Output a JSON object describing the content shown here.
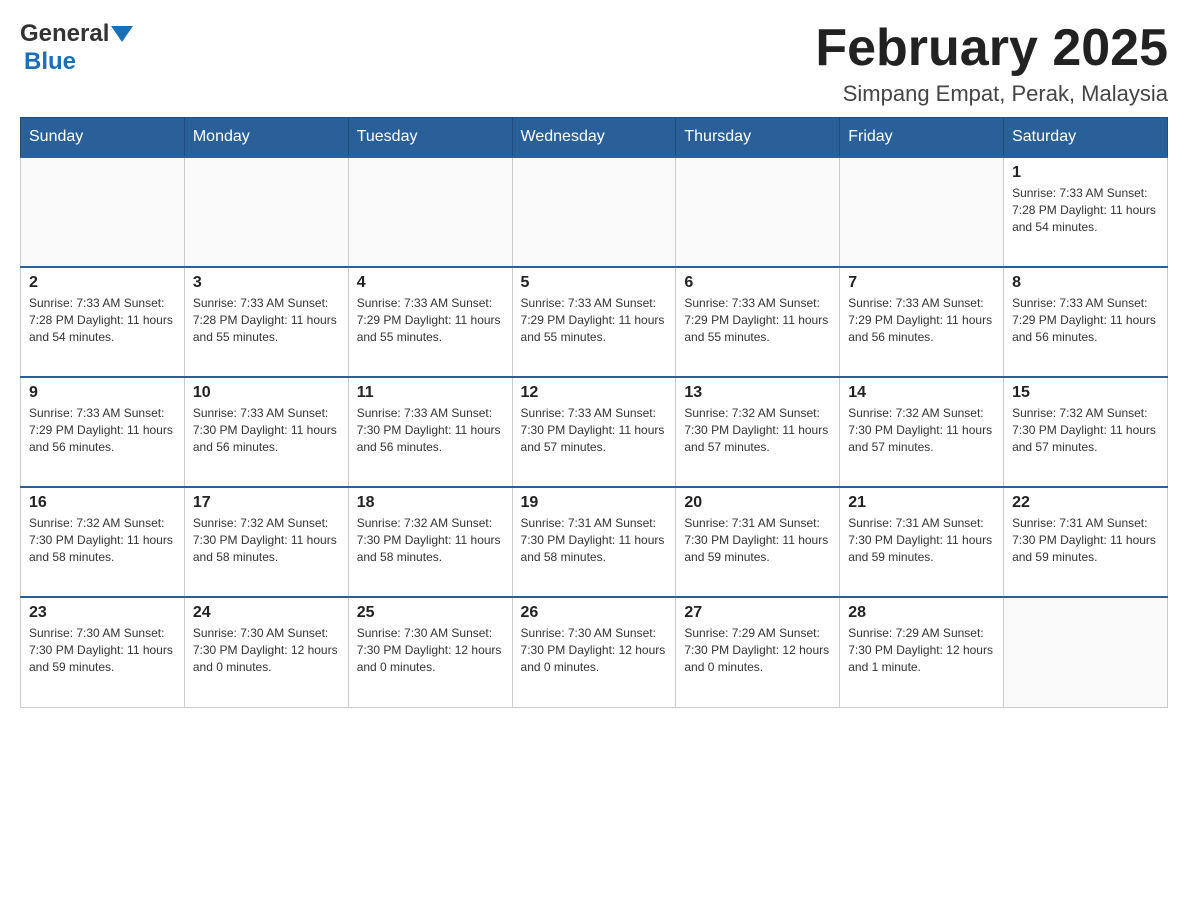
{
  "header": {
    "logo": {
      "text_general": "General",
      "text_blue": "Blue"
    },
    "title": "February 2025",
    "location": "Simpang Empat, Perak, Malaysia"
  },
  "days_of_week": [
    "Sunday",
    "Monday",
    "Tuesday",
    "Wednesday",
    "Thursday",
    "Friday",
    "Saturday"
  ],
  "weeks": [
    {
      "days": [
        {
          "number": "",
          "info": ""
        },
        {
          "number": "",
          "info": ""
        },
        {
          "number": "",
          "info": ""
        },
        {
          "number": "",
          "info": ""
        },
        {
          "number": "",
          "info": ""
        },
        {
          "number": "",
          "info": ""
        },
        {
          "number": "1",
          "info": "Sunrise: 7:33 AM\nSunset: 7:28 PM\nDaylight: 11 hours\nand 54 minutes."
        }
      ]
    },
    {
      "days": [
        {
          "number": "2",
          "info": "Sunrise: 7:33 AM\nSunset: 7:28 PM\nDaylight: 11 hours\nand 54 minutes."
        },
        {
          "number": "3",
          "info": "Sunrise: 7:33 AM\nSunset: 7:28 PM\nDaylight: 11 hours\nand 55 minutes."
        },
        {
          "number": "4",
          "info": "Sunrise: 7:33 AM\nSunset: 7:29 PM\nDaylight: 11 hours\nand 55 minutes."
        },
        {
          "number": "5",
          "info": "Sunrise: 7:33 AM\nSunset: 7:29 PM\nDaylight: 11 hours\nand 55 minutes."
        },
        {
          "number": "6",
          "info": "Sunrise: 7:33 AM\nSunset: 7:29 PM\nDaylight: 11 hours\nand 55 minutes."
        },
        {
          "number": "7",
          "info": "Sunrise: 7:33 AM\nSunset: 7:29 PM\nDaylight: 11 hours\nand 56 minutes."
        },
        {
          "number": "8",
          "info": "Sunrise: 7:33 AM\nSunset: 7:29 PM\nDaylight: 11 hours\nand 56 minutes."
        }
      ]
    },
    {
      "days": [
        {
          "number": "9",
          "info": "Sunrise: 7:33 AM\nSunset: 7:29 PM\nDaylight: 11 hours\nand 56 minutes."
        },
        {
          "number": "10",
          "info": "Sunrise: 7:33 AM\nSunset: 7:30 PM\nDaylight: 11 hours\nand 56 minutes."
        },
        {
          "number": "11",
          "info": "Sunrise: 7:33 AM\nSunset: 7:30 PM\nDaylight: 11 hours\nand 56 minutes."
        },
        {
          "number": "12",
          "info": "Sunrise: 7:33 AM\nSunset: 7:30 PM\nDaylight: 11 hours\nand 57 minutes."
        },
        {
          "number": "13",
          "info": "Sunrise: 7:32 AM\nSunset: 7:30 PM\nDaylight: 11 hours\nand 57 minutes."
        },
        {
          "number": "14",
          "info": "Sunrise: 7:32 AM\nSunset: 7:30 PM\nDaylight: 11 hours\nand 57 minutes."
        },
        {
          "number": "15",
          "info": "Sunrise: 7:32 AM\nSunset: 7:30 PM\nDaylight: 11 hours\nand 57 minutes."
        }
      ]
    },
    {
      "days": [
        {
          "number": "16",
          "info": "Sunrise: 7:32 AM\nSunset: 7:30 PM\nDaylight: 11 hours\nand 58 minutes."
        },
        {
          "number": "17",
          "info": "Sunrise: 7:32 AM\nSunset: 7:30 PM\nDaylight: 11 hours\nand 58 minutes."
        },
        {
          "number": "18",
          "info": "Sunrise: 7:32 AM\nSunset: 7:30 PM\nDaylight: 11 hours\nand 58 minutes."
        },
        {
          "number": "19",
          "info": "Sunrise: 7:31 AM\nSunset: 7:30 PM\nDaylight: 11 hours\nand 58 minutes."
        },
        {
          "number": "20",
          "info": "Sunrise: 7:31 AM\nSunset: 7:30 PM\nDaylight: 11 hours\nand 59 minutes."
        },
        {
          "number": "21",
          "info": "Sunrise: 7:31 AM\nSunset: 7:30 PM\nDaylight: 11 hours\nand 59 minutes."
        },
        {
          "number": "22",
          "info": "Sunrise: 7:31 AM\nSunset: 7:30 PM\nDaylight: 11 hours\nand 59 minutes."
        }
      ]
    },
    {
      "days": [
        {
          "number": "23",
          "info": "Sunrise: 7:30 AM\nSunset: 7:30 PM\nDaylight: 11 hours\nand 59 minutes."
        },
        {
          "number": "24",
          "info": "Sunrise: 7:30 AM\nSunset: 7:30 PM\nDaylight: 12 hours\nand 0 minutes."
        },
        {
          "number": "25",
          "info": "Sunrise: 7:30 AM\nSunset: 7:30 PM\nDaylight: 12 hours\nand 0 minutes."
        },
        {
          "number": "26",
          "info": "Sunrise: 7:30 AM\nSunset: 7:30 PM\nDaylight: 12 hours\nand 0 minutes."
        },
        {
          "number": "27",
          "info": "Sunrise: 7:29 AM\nSunset: 7:30 PM\nDaylight: 12 hours\nand 0 minutes."
        },
        {
          "number": "28",
          "info": "Sunrise: 7:29 AM\nSunset: 7:30 PM\nDaylight: 12 hours\nand 1 minute."
        },
        {
          "number": "",
          "info": ""
        }
      ]
    }
  ]
}
